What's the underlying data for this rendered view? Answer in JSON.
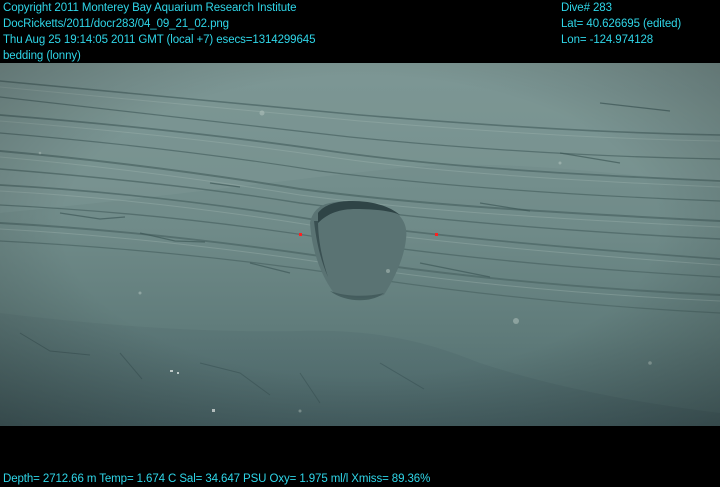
{
  "overlay": {
    "top_left": [
      "Copyright 2011 Monterey Bay Aquarium Research Institute",
      "DocRicketts/2011/docr283/04_09_21_02.png",
      "Thu Aug 25 19:14:05 2011 GMT (local +7)  esecs=1314299645",
      "bedding (lonny)"
    ],
    "top_right": [
      "Dive# 283",
      "Lat= 40.626695 (edited)",
      "Lon= -124.974128"
    ],
    "bottom": "Depth= 2712.66 m  Temp= 1.674 C  Sal= 34.647 PSU  Oxy= 1.975 ml/l  Xmiss= 89.36%"
  },
  "colors": {
    "overlay_text": "#2fd6e8",
    "frame": "#000000",
    "sediment": "#6f8a88",
    "laser_marker": "#ff2020"
  }
}
